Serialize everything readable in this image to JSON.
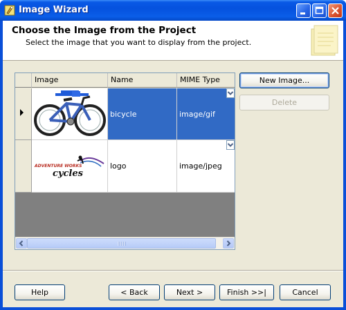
{
  "window": {
    "title": "Image Wizard"
  },
  "header": {
    "title": "Choose the Image from the Project",
    "subtitle": "Select the image that you want to display from the project."
  },
  "grid": {
    "columns": [
      "Image",
      "Name",
      "MIME Type"
    ],
    "rows": [
      {
        "image": "bicycle-image",
        "name": "bicycle",
        "mime": "image/gif",
        "selected": true
      },
      {
        "image": "adventure-works-cycles-logo",
        "name": "logo",
        "mime": "image/jpeg",
        "selected": false
      }
    ],
    "logo_text_top": "ADVENTURE WORKS",
    "logo_text_bottom": "cycles"
  },
  "side_buttons": {
    "new_image": "New Image...",
    "delete": "Delete"
  },
  "footer": {
    "help": "Help",
    "back": "< Back",
    "next": "Next >",
    "finish": "Finish >>|",
    "cancel": "Cancel"
  },
  "colors": {
    "selection": "#316ac5",
    "titlebar": "#0551de",
    "face": "#ece9d8"
  }
}
